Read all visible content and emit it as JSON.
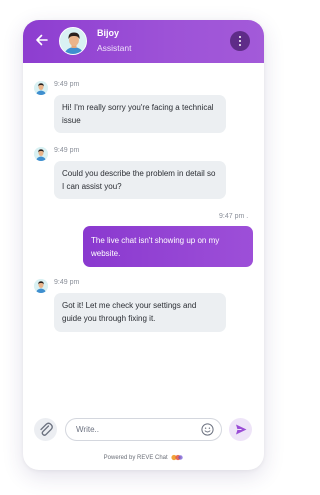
{
  "header": {
    "agent_name": "Bijoy",
    "agent_role": "Assistant",
    "back_icon": "arrow-left-icon",
    "menu_icon": "more-vertical-icon",
    "gradient_start": "#8d3dd0",
    "gradient_end": "#a35ad9"
  },
  "messages": [
    {
      "sender": "agent",
      "time": "9:49 pm",
      "text": "Hi! I'm really sorry you're facing a technical issue"
    },
    {
      "sender": "agent",
      "time": "9:49 pm",
      "text": "Could you describe the problem in detail so I can assist you?"
    },
    {
      "sender": "user",
      "time": "9:47 pm .",
      "text": "The live chat isn't showing up on my website."
    },
    {
      "sender": "agent",
      "time": "9:49 pm",
      "text": "Got it! Let me check your settings and guide you through fixing it."
    }
  ],
  "composer": {
    "placeholder": "Write..",
    "attach_icon": "paperclip-icon",
    "emoji_icon": "smiley-icon",
    "send_icon": "send-icon",
    "accent_color": "#9a4dd6"
  },
  "footer": {
    "powered_by": "Powered by",
    "brand": "REVE Chat"
  },
  "colors": {
    "agent_bubble": "#eceff2",
    "user_bubble": "#9446d3"
  }
}
